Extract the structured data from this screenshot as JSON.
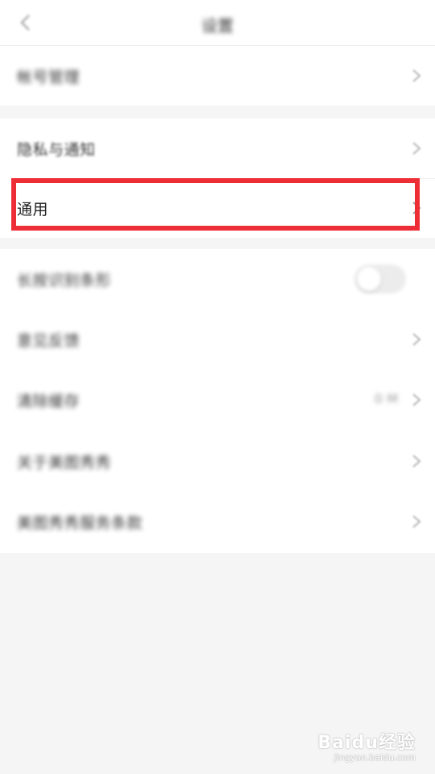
{
  "header": {
    "title": "设置"
  },
  "groups": [
    {
      "items": [
        {
          "label": "帐号管理",
          "type": "link"
        }
      ]
    },
    {
      "items": [
        {
          "label": "隐私与通知",
          "type": "link"
        },
        {
          "label": "通用",
          "type": "link",
          "highlighted": true
        }
      ]
    },
    {
      "items": [
        {
          "label": "长按识别条形",
          "type": "toggle",
          "enabled": false
        },
        {
          "label": "意见反馈",
          "type": "link"
        },
        {
          "label": "清除缓存",
          "type": "link",
          "value": "0 M"
        },
        {
          "label": "关于美图秀秀",
          "type": "link"
        },
        {
          "label": "美图秀秀服务条款",
          "type": "link"
        }
      ]
    }
  ],
  "watermark": {
    "logo": "Baidu经验",
    "url": "jingyan.baidu.com"
  },
  "colors": {
    "highlight_border": "#ee2e36",
    "background": "#f5f5f5",
    "row_background": "#ffffff"
  },
  "icons": {
    "back": "chevron-left-icon",
    "row_arrow": "chevron-right-icon"
  }
}
